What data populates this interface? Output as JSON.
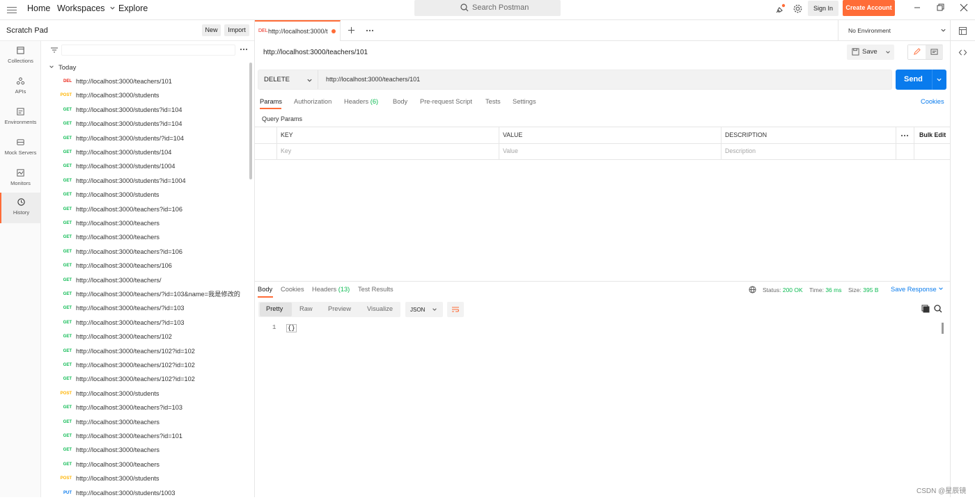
{
  "topbar": {
    "home": "Home",
    "workspaces": "Workspaces",
    "explore": "Explore",
    "search_placeholder": "Search Postman",
    "sign_in": "Sign In",
    "create_account": "Create Account"
  },
  "sidebar": {
    "title": "Scratch Pad",
    "new_label": "New",
    "import_label": "Import",
    "rail": [
      {
        "label": "Collections",
        "icon": "collections-icon"
      },
      {
        "label": "APIs",
        "icon": "apis-icon"
      },
      {
        "label": "Environments",
        "icon": "environments-icon"
      },
      {
        "label": "Mock Servers",
        "icon": "mock-servers-icon"
      },
      {
        "label": "Monitors",
        "icon": "monitors-icon"
      },
      {
        "label": "History",
        "icon": "history-icon"
      }
    ],
    "history_group": "Today",
    "history": [
      {
        "method": "DEL",
        "url": "http://localhost:3000/teachers/101"
      },
      {
        "method": "POST",
        "url": "http://localhost:3000/students"
      },
      {
        "method": "GET",
        "url": "http://localhost:3000/students?id=104"
      },
      {
        "method": "GET",
        "url": "http://localhost:3000/students?id=104"
      },
      {
        "method": "GET",
        "url": "http://localhost:3000/students/?id=104"
      },
      {
        "method": "GET",
        "url": "http://localhost:3000/students/104"
      },
      {
        "method": "GET",
        "url": "http://localhost:3000/students/1004"
      },
      {
        "method": "GET",
        "url": "http://localhost:3000/students?id=1004"
      },
      {
        "method": "GET",
        "url": "http://localhost:3000/students"
      },
      {
        "method": "GET",
        "url": "http://localhost:3000/teachers?id=106"
      },
      {
        "method": "GET",
        "url": "http://localhost:3000/teachers"
      },
      {
        "method": "GET",
        "url": "http://localhost:3000/teachers"
      },
      {
        "method": "GET",
        "url": "http://localhost:3000/teachers?id=106"
      },
      {
        "method": "GET",
        "url": "http://localhost:3000/teachers/106"
      },
      {
        "method": "GET",
        "url": "http://localhost:3000/teachers/"
      },
      {
        "method": "GET",
        "url": "http://localhost:3000/teachers/?id=103&name=我是修改的"
      },
      {
        "method": "GET",
        "url": "http://localhost:3000/teachers/?id=103"
      },
      {
        "method": "GET",
        "url": "http://localhost:3000/teachers/?id=103"
      },
      {
        "method": "GET",
        "url": "http://localhost:3000/teachers/102"
      },
      {
        "method": "GET",
        "url": "http://localhost:3000/teachers/102?id=102"
      },
      {
        "method": "GET",
        "url": "http://localhost:3000/teachers/102?id=102"
      },
      {
        "method": "GET",
        "url": "http://localhost:3000/teachers/102?id=102"
      },
      {
        "method": "POST",
        "url": "http://localhost:3000/students"
      },
      {
        "method": "GET",
        "url": "http://localhost:3000/teachers?id=103"
      },
      {
        "method": "GET",
        "url": "http://localhost:3000/teachers"
      },
      {
        "method": "GET",
        "url": "http://localhost:3000/teachers?id=101"
      },
      {
        "method": "GET",
        "url": "http://localhost:3000/teachers"
      },
      {
        "method": "GET",
        "url": "http://localhost:3000/teachers"
      },
      {
        "method": "POST",
        "url": "http://localhost:3000/students"
      },
      {
        "method": "PUT",
        "url": "http://localhost:3000/students/1003"
      }
    ]
  },
  "method_colors": {
    "GET": "#0cbb52",
    "POST": "#ffb400",
    "DEL": "#eb2013",
    "PUT": "#097bed"
  },
  "tab": {
    "method": "DEL",
    "title": "http://localhost:3000/t"
  },
  "environment": "No Environment",
  "request": {
    "title": "http://localhost:3000/teachers/101",
    "save_label": "Save",
    "method": "DELETE",
    "url": "http://localhost:3000/teachers/101",
    "send_label": "Send",
    "tabs": [
      "Params",
      "Authorization",
      "Headers",
      "Body",
      "Pre-request Script",
      "Tests",
      "Settings"
    ],
    "headers_count": "(6)",
    "cookies_label": "Cookies",
    "query_params_label": "Query Params",
    "columns": {
      "key": "KEY",
      "value": "VALUE",
      "description": "DESCRIPTION",
      "bulk_edit": "Bulk Edit"
    },
    "placeholders": {
      "key": "Key",
      "value": "Value",
      "description": "Description"
    }
  },
  "response": {
    "tabs": [
      "Body",
      "Cookies",
      "Headers",
      "Test Results"
    ],
    "headers_count": "(13)",
    "status_label": "Status:",
    "status_value": "200 OK",
    "time_label": "Time:",
    "time_value": "36 ms",
    "size_label": "Size:",
    "size_value": "395 B",
    "save_response": "Save Response",
    "formats": [
      "Pretty",
      "Raw",
      "Preview",
      "Visualize"
    ],
    "language": "JSON",
    "line_number": "1",
    "body": "{}"
  },
  "watermark": "CSDN @星辰镜"
}
